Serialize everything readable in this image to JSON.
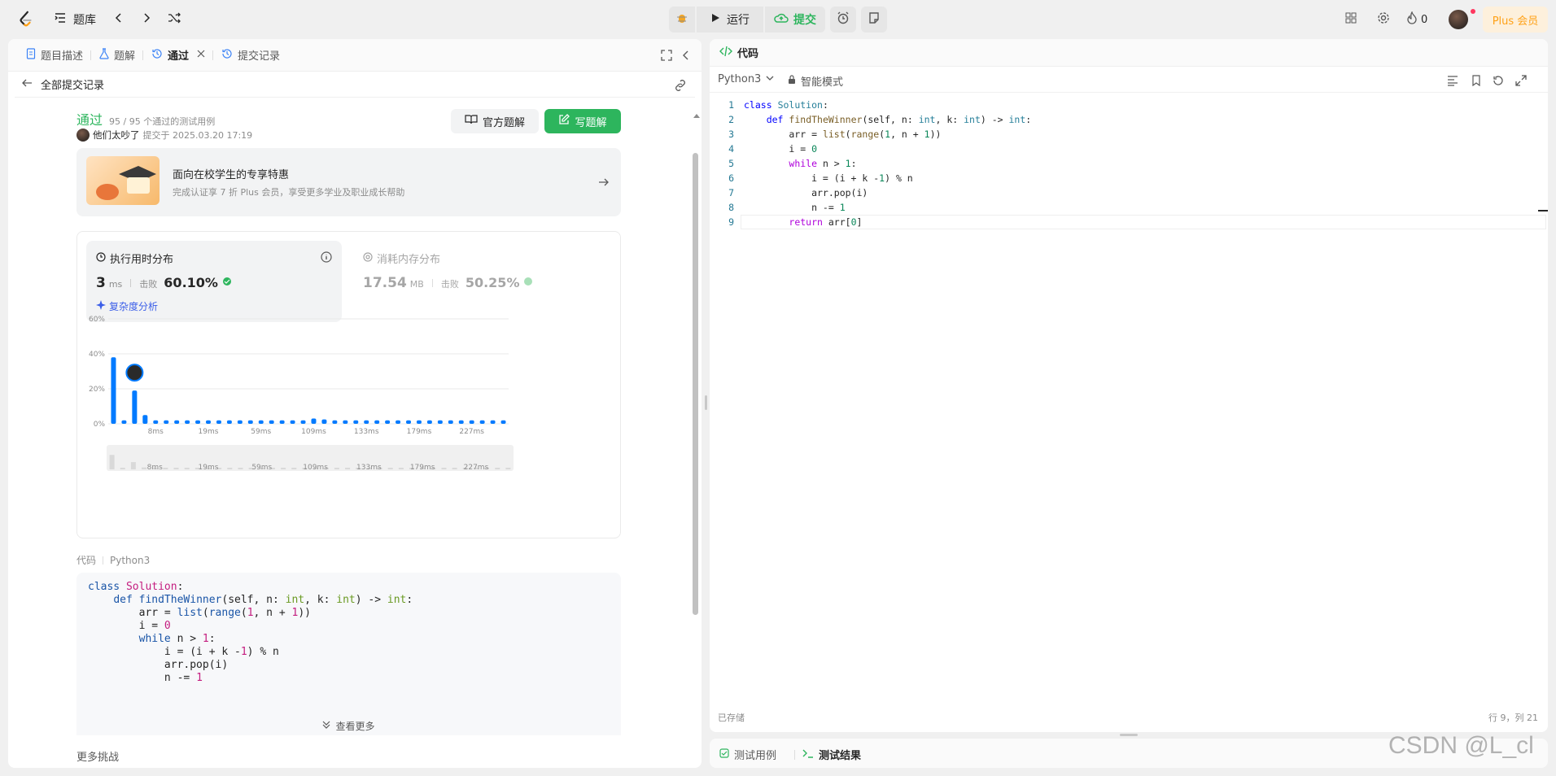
{
  "topbar": {
    "problem_list": "题库",
    "run": "运行",
    "submit": "提交",
    "streak_count": "0",
    "plus": "Plus 会员"
  },
  "left_tabs": [
    {
      "label": "题目描述"
    },
    {
      "label": "题解"
    },
    {
      "label": "通过"
    },
    {
      "label": "提交记录"
    }
  ],
  "back_link": "全部提交记录",
  "result": {
    "status": "通过",
    "cases": "95 / 95 个通过的测试用例",
    "user": "他们太吵了",
    "submitted_at": "提交于 2025.03.20 17:19",
    "official_solution": "官方题解",
    "write_solution": "写题解"
  },
  "promo": {
    "title": "面向在校学生的专享特惠",
    "subtitle": "完成认证享 7 折 Plus 会员，享受更多学业及职业成长帮助"
  },
  "runtime": {
    "title": "执行用时分布",
    "value": "3",
    "unit": "ms",
    "beat_label": "击败",
    "beat": "60.10%",
    "analysis": "复杂度分析"
  },
  "memory": {
    "title": "消耗内存分布",
    "value": "17.54",
    "unit": "MB",
    "beat_label": "击败",
    "beat": "50.25%"
  },
  "chart_data": {
    "type": "bar",
    "ylim": [
      0,
      60
    ],
    "yticks": [
      "60%",
      "40%",
      "20%",
      "0%"
    ],
    "xticks": [
      "8ms",
      "19ms",
      "59ms",
      "109ms",
      "133ms",
      "179ms",
      "227ms"
    ],
    "values": [
      38,
      2,
      19,
      5,
      2,
      2,
      2,
      2,
      2,
      2,
      2,
      2,
      2,
      2,
      2,
      2,
      2,
      2,
      2,
      3,
      2.5,
      2,
      2,
      2,
      2,
      2,
      2,
      2,
      2,
      2,
      2,
      2,
      2,
      2,
      2,
      2,
      2,
      2
    ],
    "highlight_index": 2
  },
  "code_meta": {
    "label": "代码",
    "lang": "Python3"
  },
  "preview_code": [
    "class Solution:",
    "    def findTheWinner(self, n: int, k: int) -> int:",
    "        arr = list(range(1, n + 1))",
    "        i = 0",
    "        while n > 1:",
    "            i = (i + k -1) % n",
    "            arr.pop(i)",
    "            n -= 1"
  ],
  "see_more": "查看更多",
  "more_challenges": "更多挑战",
  "editor": {
    "tab": "代码",
    "language": "Python3",
    "mode": "智能模式",
    "lines": [
      "class Solution:",
      "    def findTheWinner(self, n: int, k: int) -> int:",
      "        arr = list(range(1, n + 1))",
      "        i = 0",
      "        while n > 1:",
      "            i = (i + k -1) % n",
      "            arr.pop(i)",
      "            n -= 1",
      "        return arr[0]"
    ],
    "saved": "已存储",
    "cursor": "行 9，列 21"
  },
  "bottom_tabs": [
    {
      "label": "测试用例"
    },
    {
      "label": "测试结果"
    }
  ],
  "watermark": "CSDN @L_cl",
  "colors": {
    "accent_green": "#2db55d",
    "bar_blue": "#007aff",
    "plus_orange": "#ffa116"
  }
}
